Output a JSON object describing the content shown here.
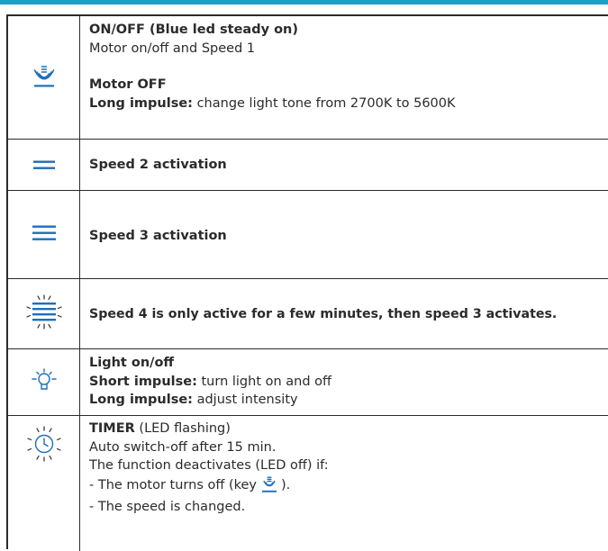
{
  "rows": [
    {
      "icon": "motor-onoff-icon",
      "title": "ON/OFF (Blue led steady on)",
      "desc": "Motor on/off and Speed 1",
      "subtitle": "Motor OFF",
      "long_label": "Long impulse:",
      "long_text": " change light tone from 2700K to 5600K"
    },
    {
      "icon": "speed-2-icon",
      "title": "Speed 2 activation"
    },
    {
      "icon": "speed-3-icon",
      "title": "Speed 3 activation"
    },
    {
      "icon": "speed-4-icon",
      "title": "Speed 4 is only active for a few minutes, then speed 3 activates."
    },
    {
      "icon": "light-bulb-icon",
      "title": "Light on/off",
      "short_label": "Short impulse:",
      "short_text": " turn light on and off",
      "long_label": "Long impulse:",
      "long_text": " adjust intensity"
    },
    {
      "icon": "timer-icon",
      "title": "TIMER",
      "title_note": " (LED flashing)",
      "line1": "Auto switch-off after 15 min.",
      "line2": "The function deactivates (LED off) if:",
      "line3_pre": "- The motor turns off (key",
      "line3_post": ").",
      "line4": "- The speed is changed."
    }
  ],
  "colors": {
    "accent": "#1aa0c4",
    "icon": "#1f6fb8",
    "text": "#2b2b2b"
  }
}
